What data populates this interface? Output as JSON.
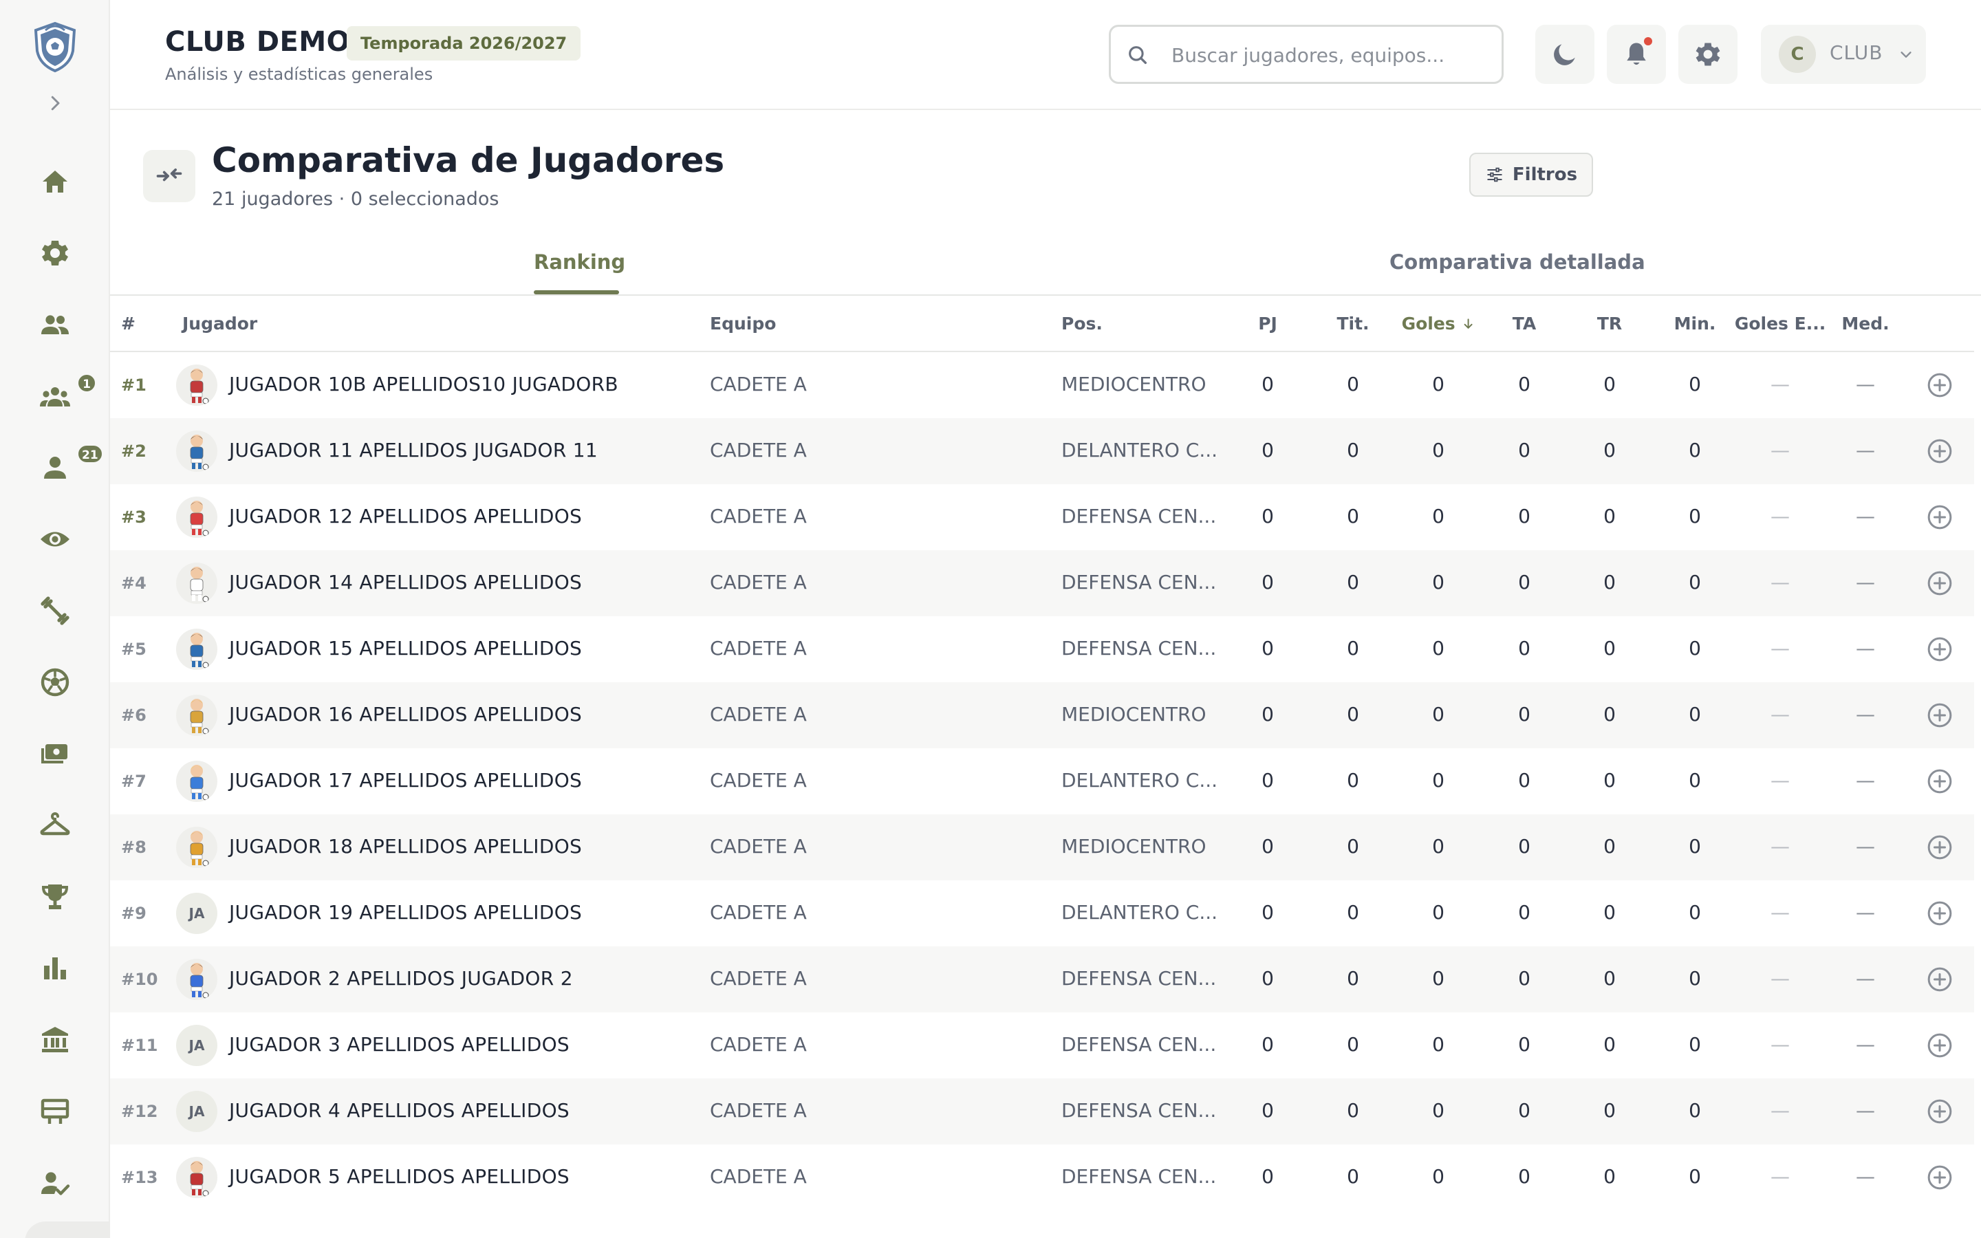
{
  "header": {
    "club_title": "CLUB DEMO",
    "season": "Temporada 2026/2027",
    "subtitle": "Análisis y estadísticas generales",
    "search_placeholder": "Buscar jugadores, equipos...",
    "user_initial": "C",
    "user_label": "CLUB"
  },
  "sidebar": {
    "items": [
      {
        "icon": "home-icon"
      },
      {
        "icon": "gear-icon"
      },
      {
        "icon": "people-icon"
      },
      {
        "icon": "groups-icon",
        "badge": "1"
      },
      {
        "icon": "person-icon",
        "badge": "21"
      },
      {
        "icon": "eye-icon"
      },
      {
        "icon": "dumbbell-icon"
      },
      {
        "icon": "soccer-ball-icon"
      },
      {
        "icon": "payments-icon"
      },
      {
        "icon": "hanger-icon"
      },
      {
        "icon": "trophy-icon"
      },
      {
        "icon": "bar-chart-icon"
      },
      {
        "icon": "institution-icon"
      },
      {
        "icon": "board-icon"
      },
      {
        "icon": "person-check-icon"
      }
    ]
  },
  "page": {
    "title": "Comparativa de Jugadores",
    "subtitle": "21 jugadores · 0 seleccionados",
    "filters_label": "Filtros"
  },
  "tabs": [
    {
      "label": "Ranking",
      "active": true
    },
    {
      "label": "Comparativa detallada",
      "active": false
    }
  ],
  "table": {
    "columns": {
      "rank": "#",
      "player": "Jugador",
      "team": "Equipo",
      "pos": "Pos.",
      "pj": "PJ",
      "tit": "Tit.",
      "goles": "Goles",
      "ta": "TA",
      "tr": "TR",
      "min": "Min.",
      "goles_e": "Goles E...",
      "med": "Med."
    },
    "rows": [
      {
        "rank": "#1",
        "name": "JUGADOR 10B APELLIDOS10 JUGADORB",
        "team": "CADETE A",
        "pos": "MEDIOCENTRO",
        "avatar": "img",
        "pj": "0",
        "tit": "0",
        "goles": "0",
        "ta": "0",
        "tr": "0",
        "min": "0",
        "goles_e": "—",
        "med": "—"
      },
      {
        "rank": "#2",
        "name": "JUGADOR 11 APELLIDOS JUGADOR 11",
        "team": "CADETE A",
        "pos": "DELANTERO C...",
        "avatar": "img",
        "pj": "0",
        "tit": "0",
        "goles": "0",
        "ta": "0",
        "tr": "0",
        "min": "0",
        "goles_e": "—",
        "med": "—"
      },
      {
        "rank": "#3",
        "name": "JUGADOR 12 APELLIDOS APELLIDOS",
        "team": "CADETE A",
        "pos": "DEFENSA CEN...",
        "avatar": "img",
        "pj": "0",
        "tit": "0",
        "goles": "0",
        "ta": "0",
        "tr": "0",
        "min": "0",
        "goles_e": "—",
        "med": "—"
      },
      {
        "rank": "#4",
        "name": "JUGADOR 14 APELLIDOS APELLIDOS",
        "team": "CADETE A",
        "pos": "DEFENSA CEN...",
        "avatar": "img",
        "pj": "0",
        "tit": "0",
        "goles": "0",
        "ta": "0",
        "tr": "0",
        "min": "0",
        "goles_e": "—",
        "med": "—"
      },
      {
        "rank": "#5",
        "name": "JUGADOR 15 APELLIDOS APELLIDOS",
        "team": "CADETE A",
        "pos": "DEFENSA CEN...",
        "avatar": "img",
        "pj": "0",
        "tit": "0",
        "goles": "0",
        "ta": "0",
        "tr": "0",
        "min": "0",
        "goles_e": "—",
        "med": "—"
      },
      {
        "rank": "#6",
        "name": "JUGADOR 16 APELLIDOS APELLIDOS",
        "team": "CADETE A",
        "pos": "MEDIOCENTRO",
        "avatar": "img",
        "pj": "0",
        "tit": "0",
        "goles": "0",
        "ta": "0",
        "tr": "0",
        "min": "0",
        "goles_e": "—",
        "med": "—"
      },
      {
        "rank": "#7",
        "name": "JUGADOR 17 APELLIDOS APELLIDOS",
        "team": "CADETE A",
        "pos": "DELANTERO C...",
        "avatar": "img",
        "pj": "0",
        "tit": "0",
        "goles": "0",
        "ta": "0",
        "tr": "0",
        "min": "0",
        "goles_e": "—",
        "med": "—"
      },
      {
        "rank": "#8",
        "name": "JUGADOR 18 APELLIDOS APELLIDOS",
        "team": "CADETE A",
        "pos": "MEDIOCENTRO",
        "avatar": "img",
        "pj": "0",
        "tit": "0",
        "goles": "0",
        "ta": "0",
        "tr": "0",
        "min": "0",
        "goles_e": "—",
        "med": "—"
      },
      {
        "rank": "#9",
        "name": "JUGADOR 19 APELLIDOS APELLIDOS",
        "team": "CADETE A",
        "pos": "DELANTERO C...",
        "avatar": "JA",
        "pj": "0",
        "tit": "0",
        "goles": "0",
        "ta": "0",
        "tr": "0",
        "min": "0",
        "goles_e": "—",
        "med": "—"
      },
      {
        "rank": "#10",
        "name": "JUGADOR 2 APELLIDOS JUGADOR 2",
        "team": "CADETE A",
        "pos": "DEFENSA CEN...",
        "avatar": "img",
        "pj": "0",
        "tit": "0",
        "goles": "0",
        "ta": "0",
        "tr": "0",
        "min": "0",
        "goles_e": "—",
        "med": "—"
      },
      {
        "rank": "#11",
        "name": "JUGADOR 3 APELLIDOS APELLIDOS",
        "team": "CADETE A",
        "pos": "DEFENSA CEN...",
        "avatar": "JA",
        "pj": "0",
        "tit": "0",
        "goles": "0",
        "ta": "0",
        "tr": "0",
        "min": "0",
        "goles_e": "—",
        "med": "—"
      },
      {
        "rank": "#12",
        "name": "JUGADOR 4 APELLIDOS APELLIDOS",
        "team": "CADETE A",
        "pos": "DEFENSA CEN...",
        "avatar": "JA",
        "pj": "0",
        "tit": "0",
        "goles": "0",
        "ta": "0",
        "tr": "0",
        "min": "0",
        "goles_e": "—",
        "med": "—"
      },
      {
        "rank": "#13",
        "name": "JUGADOR 5 APELLIDOS APELLIDOS",
        "team": "CADETE A",
        "pos": "DEFENSA CEN...",
        "avatar": "img",
        "pj": "0",
        "tit": "0",
        "goles": "0",
        "ta": "0",
        "tr": "0",
        "min": "0",
        "goles_e": "—",
        "med": "—"
      }
    ]
  },
  "colors": {
    "accent": "#6f7a52",
    "notification_dot": "#e04f3f",
    "sidebar_bg": "#f7f7f6"
  }
}
